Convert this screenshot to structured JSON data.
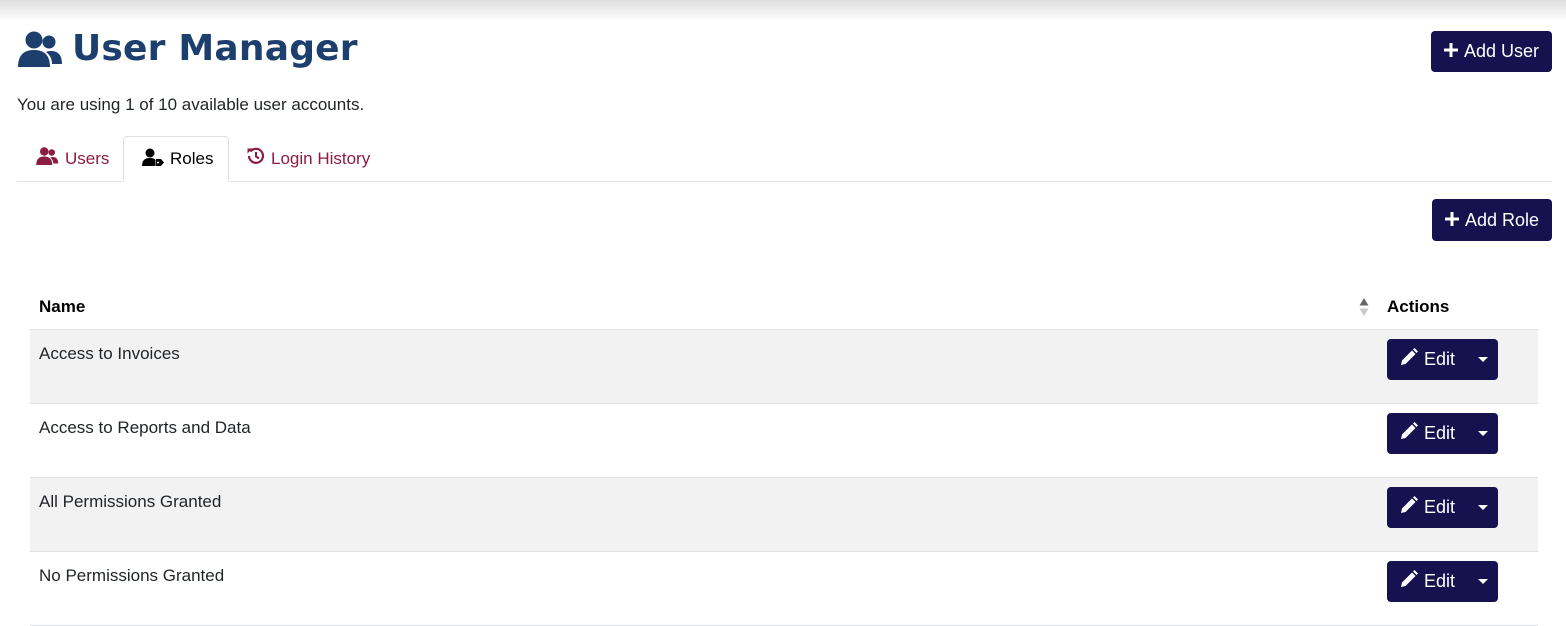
{
  "header": {
    "title": "User Manager",
    "icon": "users-icon",
    "add_user_label": "Add User"
  },
  "usage_text": "You are using 1 of 10 available user accounts.",
  "tabs": [
    {
      "label": "Users",
      "icon": "users-icon",
      "active": false
    },
    {
      "label": "Roles",
      "icon": "user-tag-icon",
      "active": true
    },
    {
      "label": "Login History",
      "icon": "history-icon",
      "active": false
    }
  ],
  "add_role_label": "Add Role",
  "table": {
    "columns": [
      "Name",
      "Actions"
    ],
    "rows": [
      {
        "name": "Access to Invoices",
        "action": "Edit"
      },
      {
        "name": "Access to Reports and Data",
        "action": "Edit"
      },
      {
        "name": "All Permissions Granted",
        "action": "Edit"
      },
      {
        "name": "No Permissions Granted",
        "action": "Edit"
      }
    ]
  },
  "colors": {
    "title": "#1c3f6e",
    "button": "#15124f",
    "tab_link": "#8b1d41",
    "row_stripe": "#f2f2f2"
  }
}
